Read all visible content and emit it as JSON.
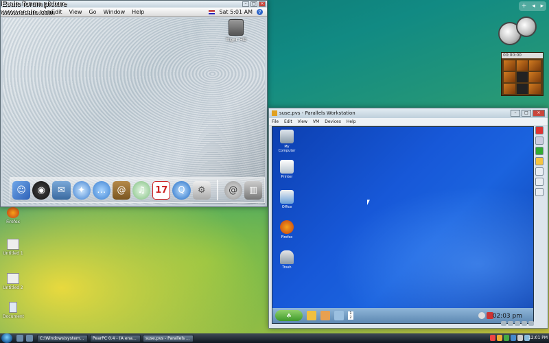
{
  "watermark": {
    "line1": "Esato forum picture",
    "line2": "www.esato.com"
  },
  "mac": {
    "menu": [
      "Edit",
      "View",
      "Go",
      "Window",
      "Help"
    ],
    "clock": "Sat 5:01 AM",
    "drive_label": "Tiger HD",
    "dock_icons": [
      "finder",
      "dashboard",
      "mail",
      "safari",
      "ichat",
      "address-book",
      "itunes",
      "ical",
      "quicktime",
      "system-preferences",
      "trash"
    ]
  },
  "parallels": {
    "title": "suse.pvs - Parallels Workstation",
    "menu": [
      "File",
      "Edit",
      "View",
      "VM",
      "Devices",
      "Help"
    ],
    "guest_icons": [
      {
        "label": "My Computer",
        "kind": "computer"
      },
      {
        "label": "Printer",
        "kind": "printer"
      },
      {
        "label": "Office",
        "kind": "office"
      },
      {
        "label": "Firefox",
        "kind": "firefox"
      },
      {
        "label": "Trash",
        "kind": "trash"
      }
    ],
    "guest_clock": "02:03 pm",
    "pager": [
      "1",
      "2"
    ]
  },
  "desktop_icons": [
    {
      "label": "Firefox",
      "kind": "firefox"
    },
    {
      "label": "Untitled 1",
      "kind": "file"
    },
    {
      "label": "Untitled 2",
      "kind": "file"
    },
    {
      "label": "Document",
      "kind": "doc"
    }
  ],
  "gadget": {
    "photo_title": "00:00:00"
  },
  "taskbar": {
    "buttons": [
      "C:\\Windows\\system...",
      "PearPC 0.4 - (A ena...",
      "suse.pvs - Parallels ..."
    ],
    "clock": "12:01 PM"
  }
}
